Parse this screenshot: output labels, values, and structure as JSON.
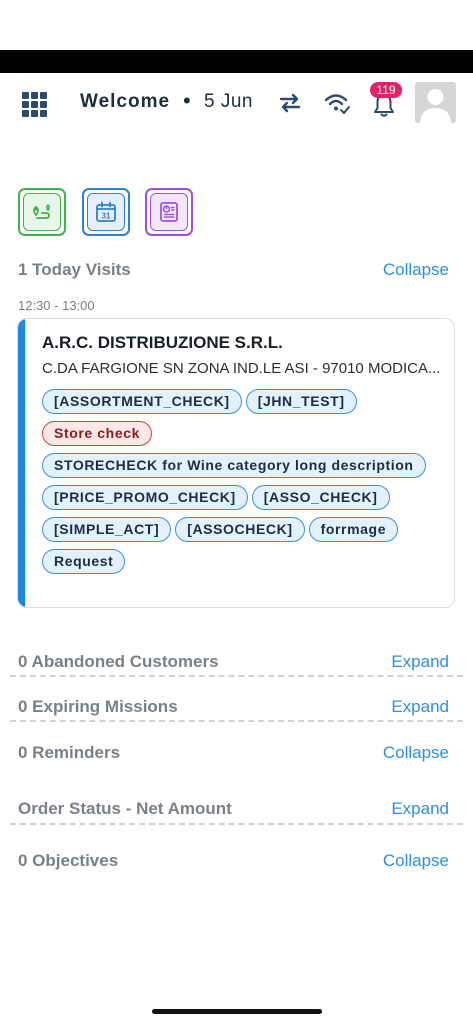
{
  "header": {
    "welcome": "Welcome",
    "date": "5 Jun",
    "notification_count": "119"
  },
  "quick_actions": [
    {
      "icon": "route-map-icon",
      "color": "#3fb44a"
    },
    {
      "icon": "calendar-icon",
      "day": "31",
      "color": "#2f7fd6"
    },
    {
      "icon": "report-chart-icon",
      "color": "#a24fe0"
    }
  ],
  "visits": {
    "title": "1 Today Visits",
    "toggle": "Collapse",
    "items": [
      {
        "time": "12:30 - 13:00",
        "customer": "A.R.C. DISTRIBUZIONE S.R.L.",
        "address": "C.DA FARGIONE SN ZONA IND.LE ASI - 97010 MODICA...",
        "tags": [
          {
            "label": "[ASSORTMENT_CHECK]",
            "style": "blue"
          },
          {
            "label": "[JHN_TEST]",
            "style": "blue"
          },
          {
            "label": "Store check",
            "style": "red"
          },
          {
            "label": "STORECHECK for Wine category long description",
            "style": "blue"
          },
          {
            "label": "[PRICE_PROMO_CHECK]",
            "style": "blue"
          },
          {
            "label": "[ASSO_CHECK]",
            "style": "blue"
          },
          {
            "label": "[SIMPLE_ACT]",
            "style": "blue"
          },
          {
            "label": "[ASSOCHECK]",
            "style": "blue"
          },
          {
            "label": "forrmage",
            "style": "blue"
          },
          {
            "label": "Request",
            "style": "blue"
          }
        ]
      }
    ]
  },
  "sections": [
    {
      "title": "0 Abandoned Customers",
      "toggle": "Expand"
    },
    {
      "title": "0 Expiring Missions",
      "toggle": "Expand"
    },
    {
      "title": "0 Reminders",
      "toggle": "Collapse"
    },
    {
      "title": "Order Status - Net Amount",
      "toggle": "Expand"
    },
    {
      "title": "0 Objectives",
      "toggle": "Collapse"
    }
  ],
  "colors": {
    "accent": "#1e88e5",
    "link": "#2f8fe0",
    "badge": "#e91e63"
  }
}
